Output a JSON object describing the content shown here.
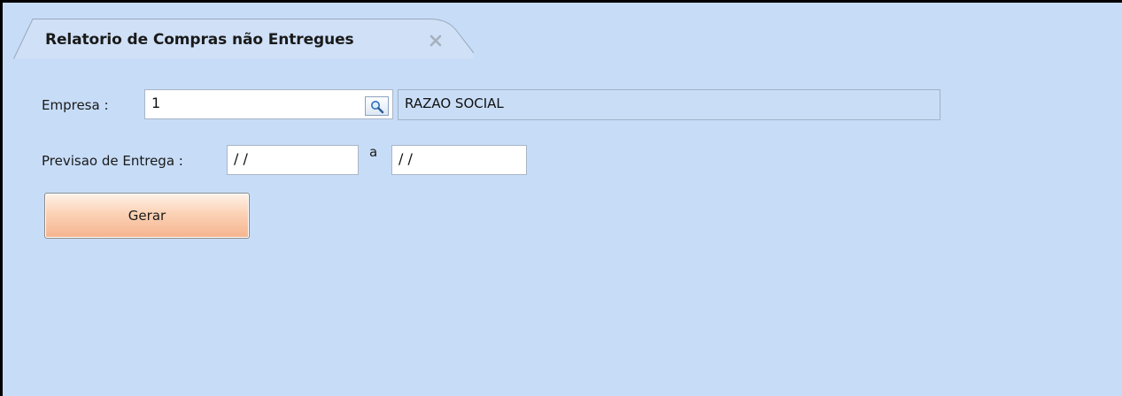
{
  "tab": {
    "title": "Relatorio de Compras não Entregues",
    "close_icon": "close-icon"
  },
  "form": {
    "empresa_label": "Empresa :",
    "empresa_code": "1",
    "empresa_lookup_icon": "search-icon",
    "empresa_name": "RAZAO SOCIAL",
    "previsao_label": "Previsao de Entrega :",
    "date_from": " /  /",
    "range_separator": "a",
    "date_to": " /  /"
  },
  "actions": {
    "gerar_label": "Gerar"
  },
  "colors": {
    "background": "#c7dcf7",
    "button_gradient_top": "#fff2e8",
    "button_gradient_bottom": "#f6b48e"
  }
}
